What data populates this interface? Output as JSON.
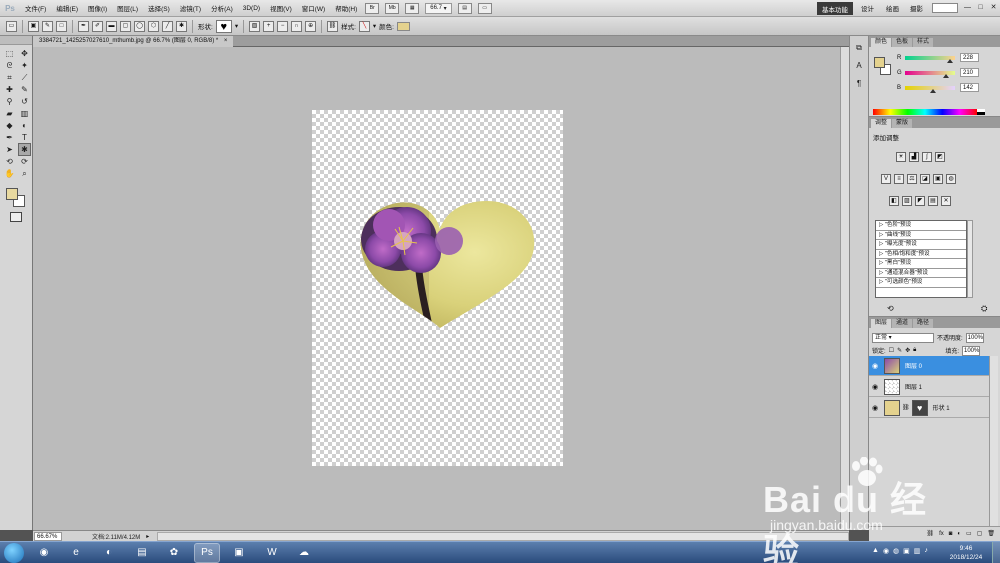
{
  "app": {
    "logo": "Ps",
    "menus": [
      "文件(F)",
      "编辑(E)",
      "图像(I)",
      "图层(L)",
      "选择(S)",
      "滤镜(T)",
      "分析(A)",
      "3D(D)",
      "视图(V)",
      "窗口(W)",
      "帮助(H)"
    ],
    "zoom_level": "66.7",
    "workspaces": {
      "active": "基本功能",
      "items": [
        "设计",
        "绘画",
        "摄影"
      ]
    },
    "window_buttons": [
      "—",
      "□",
      "✕"
    ]
  },
  "options_bar": {
    "shape_label": "形状:",
    "style_label": "样式:",
    "color_label": "颜色:",
    "shape_glyph": "♥",
    "color_hex": "#e4d28e"
  },
  "toolbar": {
    "fg_color": "#e8d9a0",
    "bg_color": "#ffffff"
  },
  "document": {
    "tab_title": "3384721_1425257027610_mthumb.jpg @ 66.7% (图层 0, RGB/8) *",
    "close": "×"
  },
  "status": {
    "zoom": "66.67%",
    "doc_info": "文档:2.11M/4.12M",
    "arrow": "▸"
  },
  "color_panel": {
    "tabs": [
      "颜色",
      "色板",
      "样式"
    ],
    "r_label": "R",
    "g_label": "G",
    "b_label": "B",
    "r": "228",
    "g": "210",
    "b": "142",
    "swatch_hex": "#e4d28e"
  },
  "adjustments_panel": {
    "tabs": [
      "调整",
      "蒙版"
    ],
    "title": "添加调整",
    "presets": [
      "\"色阶\"预设",
      "\"曲线\"预设",
      "\"曝光度\"预设",
      "\"色相/饱和度\"预设",
      "\"黑白\"预设",
      "\"通道混合器\"预设",
      "\"可选颜色\"预设"
    ]
  },
  "layers_panel": {
    "tabs": [
      "图层",
      "通道",
      "路径"
    ],
    "blend_mode": "正常",
    "opacity_label": "不透明度:",
    "opacity": "100%",
    "lock_label": "锁定:",
    "fill_label": "填充:",
    "fill": "100%",
    "layers": [
      {
        "name": "图层 0",
        "selected": true
      },
      {
        "name": "图层 1",
        "selected": false
      },
      {
        "name": "形状 1",
        "selected": false
      }
    ]
  },
  "taskbar": {
    "time": "9:46",
    "date": "2018/12/24"
  },
  "watermark": {
    "brand": "Bai du 经验",
    "url": "jingyan.baidu.com"
  }
}
